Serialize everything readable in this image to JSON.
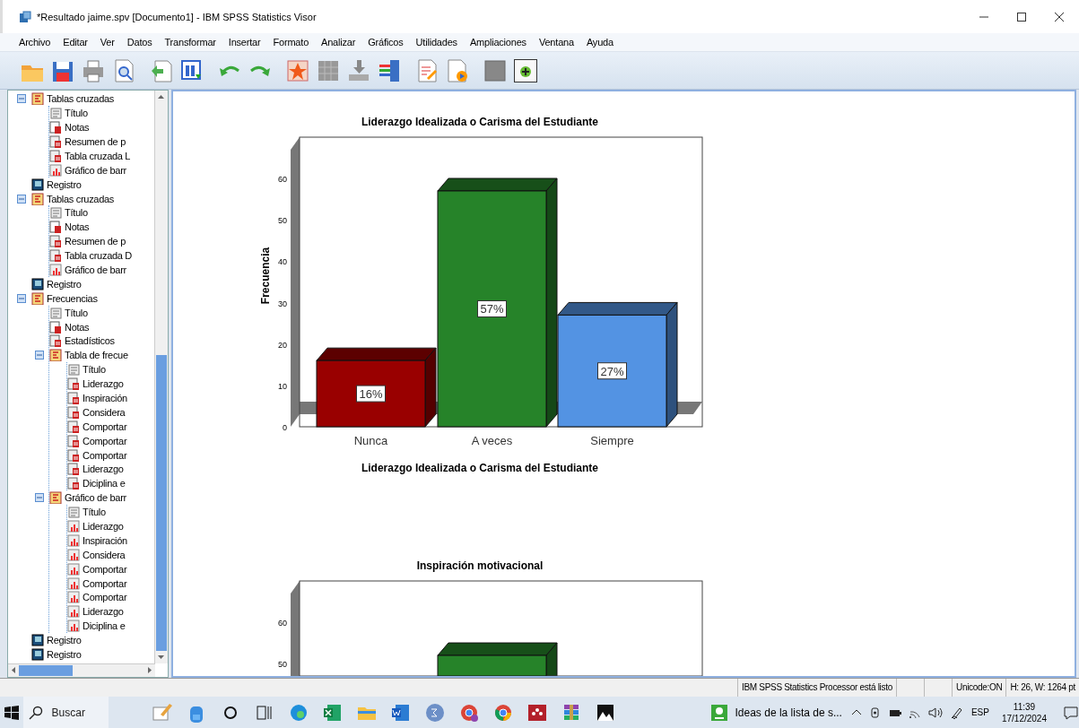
{
  "window": {
    "title": "*Resultado jaime.spv [Documento1] - IBM SPSS Statistics Visor"
  },
  "menu": [
    "Archivo",
    "Editar",
    "Ver",
    "Datos",
    "Transformar",
    "Insertar",
    "Formato",
    "Analizar",
    "Gráficos",
    "Utilidades",
    "Ampliaciones",
    "Ventana",
    "Ayuda"
  ],
  "outline": [
    {
      "label": "Tablas cruzadas",
      "kind": "heading",
      "expanded": true,
      "children": [
        {
          "label": "Título",
          "kind": "title"
        },
        {
          "label": "Notas",
          "kind": "notes"
        },
        {
          "label": "Resumen de p",
          "kind": "table"
        },
        {
          "label": "Tabla cruzada L",
          "kind": "table"
        },
        {
          "label": "Gráfico de barr",
          "kind": "chart"
        }
      ]
    },
    {
      "label": "Registro",
      "kind": "log"
    },
    {
      "label": "Tablas cruzadas",
      "kind": "heading",
      "expanded": true,
      "children": [
        {
          "label": "Título",
          "kind": "title"
        },
        {
          "label": "Notas",
          "kind": "notes"
        },
        {
          "label": "Resumen de p",
          "kind": "table"
        },
        {
          "label": "Tabla cruzada D",
          "kind": "table"
        },
        {
          "label": "Gráfico de barr",
          "kind": "chart"
        }
      ]
    },
    {
      "label": "Registro",
      "kind": "log"
    },
    {
      "label": "Frecuencias",
      "kind": "heading",
      "expanded": true,
      "children": [
        {
          "label": "Título",
          "kind": "title"
        },
        {
          "label": "Notas",
          "kind": "notes"
        },
        {
          "label": "Estadísticos",
          "kind": "table"
        },
        {
          "label": "Tabla de frecue",
          "kind": "heading",
          "expanded": true,
          "children": [
            {
              "label": "Título",
              "kind": "title"
            },
            {
              "label": "Liderazgo",
              "kind": "table"
            },
            {
              "label": "Inspiración",
              "kind": "table"
            },
            {
              "label": "Considera",
              "kind": "table"
            },
            {
              "label": "Comportar",
              "kind": "table"
            },
            {
              "label": "Comportar",
              "kind": "table"
            },
            {
              "label": "Comportar",
              "kind": "table"
            },
            {
              "label": "Liderazgo",
              "kind": "table"
            },
            {
              "label": "Diciplina e",
              "kind": "table"
            }
          ]
        },
        {
          "label": "Gráfico de barr",
          "kind": "heading",
          "expanded": true,
          "children": [
            {
              "label": "Título",
              "kind": "title"
            },
            {
              "label": "Liderazgo",
              "kind": "chart"
            },
            {
              "label": "Inspiración",
              "kind": "chart"
            },
            {
              "label": "Considera",
              "kind": "chart"
            },
            {
              "label": "Comportar",
              "kind": "chart"
            },
            {
              "label": "Comportar",
              "kind": "chart"
            },
            {
              "label": "Comportar",
              "kind": "chart"
            },
            {
              "label": "Liderazgo",
              "kind": "chart"
            },
            {
              "label": "Diciplina e",
              "kind": "chart"
            }
          ]
        }
      ]
    },
    {
      "label": "Registro",
      "kind": "log"
    },
    {
      "label": "Registro",
      "kind": "log"
    }
  ],
  "charts": [
    {
      "chart_data": {
        "type": "bar",
        "title": "Liderazgo Idealizada o Carisma del Estudiante",
        "xlabel": "Liderazgo Idealizada o Carisma del Estudiante",
        "ylabel": "Frecuencia",
        "categories": [
          "Nunca",
          "A veces",
          "Siempre"
        ],
        "values": [
          16,
          57,
          27
        ],
        "colors": [
          "#990000",
          "#268329",
          "#5393e3"
        ],
        "ylim": [
          0,
          70
        ],
        "yticks": [
          0,
          10,
          20,
          30,
          40,
          50,
          60
        ],
        "value_labels": [
          "16%",
          "57%",
          "27%"
        ]
      }
    },
    {
      "chart_data": {
        "type": "bar",
        "title": "Inspiración motivacional",
        "values": [
          null,
          52,
          null
        ],
        "colors": [
          null,
          "#268329",
          null
        ],
        "ylim": [
          47,
          70
        ],
        "yticks": [
          50,
          60
        ]
      }
    }
  ],
  "status_bar": {
    "message": "IBM SPSS Statistics Processor está listo",
    "encoding": "Unicode:ON",
    "size": "H: 26, W: 1264 pt"
  },
  "taskbar": {
    "search_placeholder": "Buscar",
    "window_label": "Ideas de la lista de s...",
    "language": "ESP",
    "time": "11:39",
    "date": "17/12/2024"
  }
}
